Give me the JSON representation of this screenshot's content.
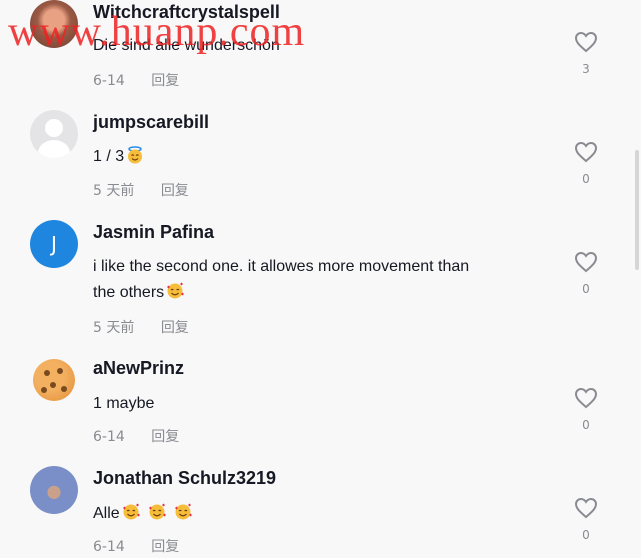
{
  "watermark": "www.huanp.com",
  "comments": [
    {
      "username": "Witchcraftcrystalspell",
      "text": "Die sind alle wunderschön",
      "date": "6-14",
      "reply": "回复",
      "likes": "3",
      "avatar": "photo"
    },
    {
      "username": "jumpscarebill",
      "text": "1 / 3",
      "emoji": "angel-face",
      "date": "5 天前",
      "reply": "回复",
      "likes": "0",
      "avatar": "default"
    },
    {
      "username": "Jasmin Pafina",
      "avatar_letter": "J",
      "text_line1": "i like the second one. it allowes more movement than",
      "text_line2": "the others",
      "emoji": "smiling-face-with-hearts",
      "date": "5 天前",
      "reply": "回复",
      "likes": "0",
      "avatar": "letter"
    },
    {
      "username": "aNewPrinz",
      "text": "1 maybe",
      "date": "6-14",
      "reply": "回复",
      "likes": "0",
      "avatar": "cookie"
    },
    {
      "username": "Jonathan Schulz3219",
      "text": "Alle",
      "emoji": "smiling-face-with-hearts x3",
      "date": "6-14",
      "reply": "回复",
      "likes": "0",
      "avatar": "llama"
    }
  ],
  "colors": {
    "text": "#161823",
    "secondary": "#8a8b91",
    "background": "#f8f8f8",
    "avatar_blue": "#1f86e0"
  }
}
